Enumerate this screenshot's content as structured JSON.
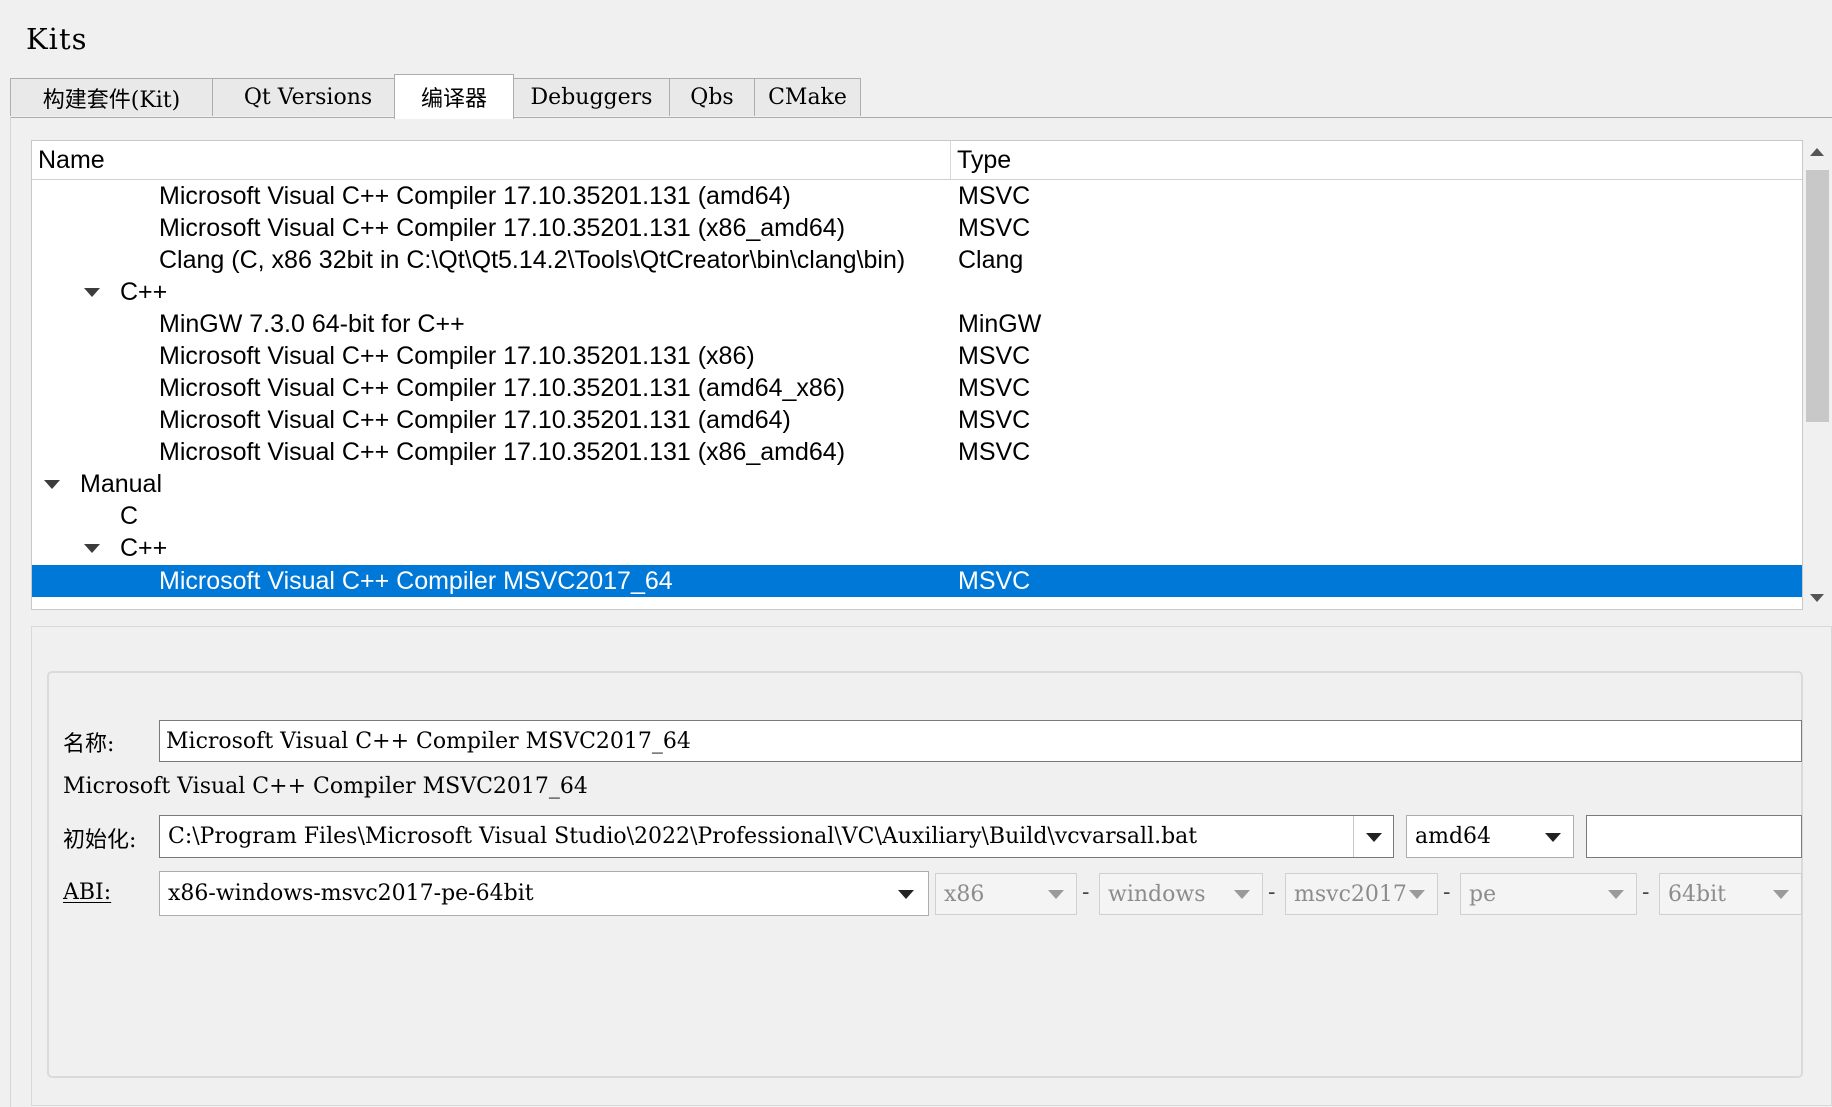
{
  "window_title": "Kits",
  "tabs": [
    {
      "label": "构建套件(Kit)"
    },
    {
      "label": "Qt Versions"
    },
    {
      "label": "编译器"
    },
    {
      "label": "Debuggers"
    },
    {
      "label": "Qbs"
    },
    {
      "label": "CMake"
    }
  ],
  "active_tab": "编译器",
  "tree": {
    "columns": {
      "name": "Name",
      "type": "Type"
    },
    "rows": [
      {
        "name": "Microsoft Visual C++ Compiler 17.10.35201.131 (amd64)",
        "type": "MSVC"
      },
      {
        "name": "Microsoft Visual C++ Compiler 17.10.35201.131 (x86_amd64)",
        "type": "MSVC"
      },
      {
        "name": "Clang (C, x86 32bit in C:\\Qt\\Qt5.14.2\\Tools\\QtCreator\\bin\\clang\\bin)",
        "type": "Clang"
      },
      {
        "name": "C++",
        "type": ""
      },
      {
        "name": "MinGW 7.3.0 64-bit for C++",
        "type": "MinGW"
      },
      {
        "name": "Microsoft Visual C++ Compiler 17.10.35201.131 (x86)",
        "type": "MSVC"
      },
      {
        "name": "Microsoft Visual C++ Compiler 17.10.35201.131 (amd64_x86)",
        "type": "MSVC"
      },
      {
        "name": "Microsoft Visual C++ Compiler 17.10.35201.131 (amd64)",
        "type": "MSVC"
      },
      {
        "name": "Microsoft Visual C++ Compiler 17.10.35201.131 (x86_amd64)",
        "type": "MSVC"
      },
      {
        "name": "Manual",
        "type": ""
      },
      {
        "name": "C",
        "type": ""
      },
      {
        "name": "C++",
        "type": ""
      },
      {
        "name": "Microsoft Visual C++ Compiler MSVC2017_64",
        "type": "MSVC"
      }
    ]
  },
  "details": {
    "name_label": "名称:",
    "name_value": "Microsoft Visual C++ Compiler MSVC2017_64",
    "display_name": "Microsoft Visual C++ Compiler MSVC2017_64",
    "init_label": "初始化:",
    "init_value": "C:\\Program Files\\Microsoft Visual Studio\\2022\\Professional\\VC\\Auxiliary\\Build\\vcvarsall.bat",
    "arch_value": "amd64",
    "extra_value": "",
    "abi_label": "ABI:",
    "abi_value": "x86-windows-msvc2017-pe-64bit",
    "abi_parts": [
      "x86",
      "windows",
      "msvc2017",
      "pe",
      "64bit"
    ],
    "abi_separator": "-"
  },
  "colors": {
    "selection": "#0078d7",
    "background": "#f0f0f0"
  }
}
